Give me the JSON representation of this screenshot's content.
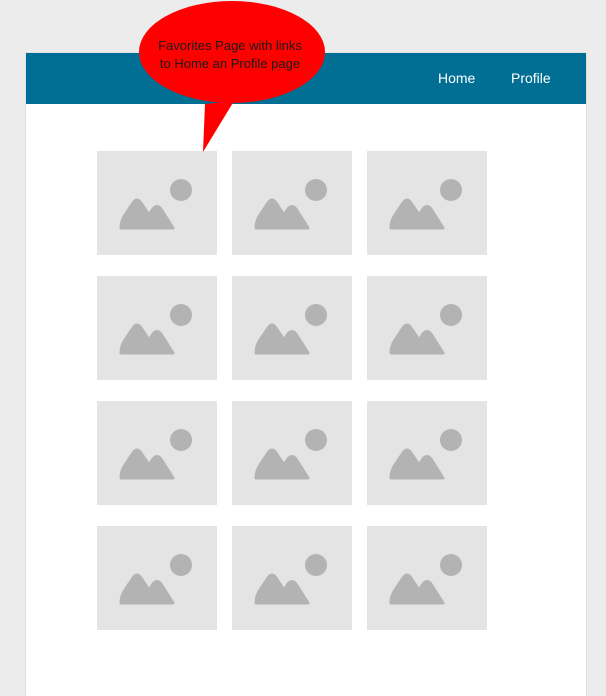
{
  "header": {
    "nav": [
      {
        "label": "Home"
      },
      {
        "label": "Profile"
      }
    ],
    "background_color": "#006f93"
  },
  "favorites": {
    "rows": 4,
    "columns": 3,
    "items": [
      {
        "icon": "image-placeholder-icon"
      },
      {
        "icon": "image-placeholder-icon"
      },
      {
        "icon": "image-placeholder-icon"
      },
      {
        "icon": "image-placeholder-icon"
      },
      {
        "icon": "image-placeholder-icon"
      },
      {
        "icon": "image-placeholder-icon"
      },
      {
        "icon": "image-placeholder-icon"
      },
      {
        "icon": "image-placeholder-icon"
      },
      {
        "icon": "image-placeholder-icon"
      },
      {
        "icon": "image-placeholder-icon"
      },
      {
        "icon": "image-placeholder-icon"
      },
      {
        "icon": "image-placeholder-icon"
      }
    ]
  },
  "annotation": {
    "lines": [
      "Favorites Page with links",
      "to Home an Profile page"
    ],
    "color": "#ff0000"
  }
}
